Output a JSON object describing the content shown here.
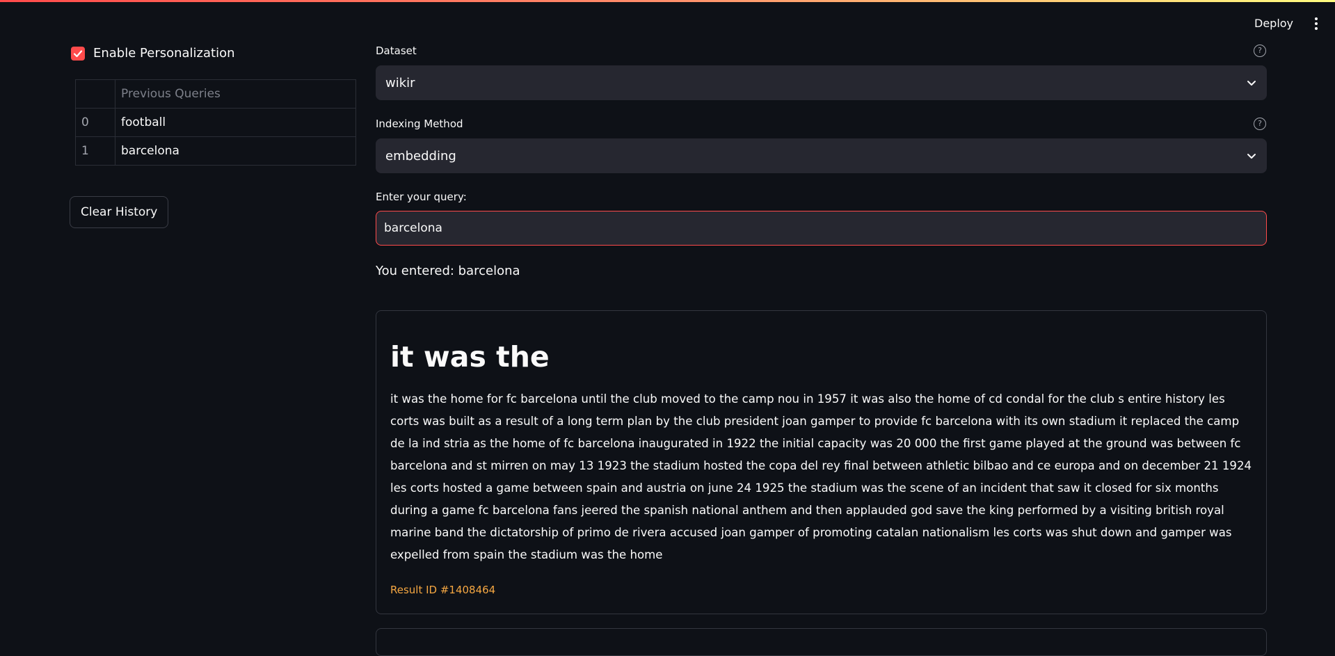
{
  "header": {
    "deploy_label": "Deploy",
    "menu_icon": "kebab-menu-icon"
  },
  "sidebar": {
    "personalization": {
      "label": "Enable Personalization",
      "checked": true
    },
    "history": {
      "column_header": "Previous Queries",
      "rows": [
        {
          "index": "0",
          "query": "football"
        },
        {
          "index": "1",
          "query": "barcelona"
        }
      ]
    },
    "clear_label": "Clear History"
  },
  "main": {
    "dataset": {
      "label": "Dataset",
      "value": "wikir"
    },
    "indexing": {
      "label": "Indexing Method",
      "value": "embedding"
    },
    "query": {
      "label": "Enter your query:",
      "value": "barcelona"
    },
    "entered_text": "You entered: barcelona",
    "result": {
      "title": "it was the",
      "body": "it was the home for fc barcelona until the club moved to the camp nou in 1957 it was also the home of cd condal for the club s entire history les corts was built as a result of a long term plan by the club president joan gamper to provide fc barcelona with its own stadium it replaced the camp de la ind stria as the home of fc barcelona inaugurated in 1922 the initial capacity was 20 000 the first game played at the ground was between fc barcelona and st mirren on may 13 1923 the stadium hosted the copa del rey final between athletic bilbao and ce europa and on december 21 1924 les corts hosted a game between spain and austria on june 24 1925 the stadium was the scene of an incident that saw it closed for six months during a game fc barcelona fans jeered the spanish national anthem and then applauded god save the king performed by a visiting british royal marine band the dictatorship of primo de rivera accused joan gamper of promoting catalan nationalism les corts was shut down and gamper was expelled from spain the stadium was the home",
      "id_text": "Result ID #1408464"
    }
  },
  "colors": {
    "background": "#0e1117",
    "accent": "#ff4b4b",
    "input_bg": "#262730",
    "result_id": "#f5a742"
  }
}
